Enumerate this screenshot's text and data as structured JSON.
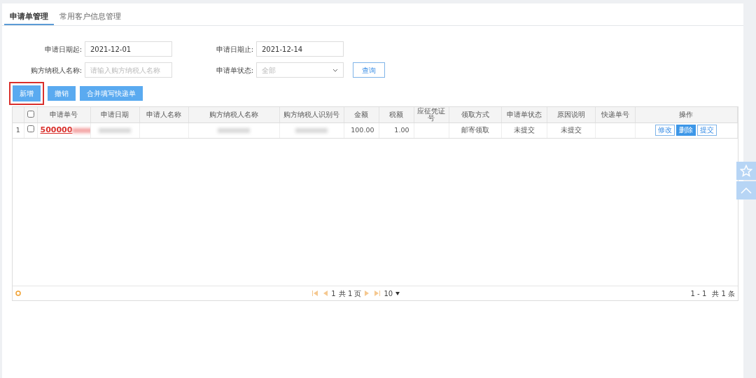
{
  "tabs": [
    {
      "label": "申请单管理",
      "selected": true
    },
    {
      "label": "常用客户信息管理",
      "selected": false
    }
  ],
  "filters": [
    {
      "kind": "text",
      "label": "申请日期起:",
      "value": "2021-12-01"
    },
    {
      "kind": "text",
      "label": "申请日期止:",
      "value": "2021-12-14"
    },
    {
      "kind": "text",
      "label": "购方纳税人名称:",
      "placeholder": "请输入购方纳税人名称"
    },
    {
      "kind": "select",
      "label": "申请单状态:",
      "placeholder": "全部"
    }
  ],
  "query_button": "查询",
  "actions": [
    {
      "label": "新增",
      "highlighted": true
    },
    {
      "label": "撤销",
      "highlighted": false
    },
    {
      "label": "合并填写快递单",
      "highlighted": false
    }
  ],
  "table": {
    "all_checked": false,
    "columns": [
      "申请单号",
      "申请日期",
      "申请人名称",
      "购方纳税人名称",
      "购方纳税人识别号",
      "金额",
      "税额",
      "应征凭证号",
      "领取方式",
      "申请单状态",
      "原因说明",
      "快递单号",
      "操作"
    ],
    "rows": [
      {
        "index": "1",
        "checked": false,
        "cells": [
          "500000",
          "",
          "",
          "",
          "",
          "100.00",
          "1.00",
          "",
          "邮寄领取",
          "未提交",
          "未提交",
          ""
        ],
        "redacted": [
          true,
          true,
          false,
          true,
          true,
          false,
          false,
          false,
          false,
          false,
          false,
          false
        ],
        "ops": [
          {
            "label": "修改",
            "kind": "outline"
          },
          {
            "label": "删除",
            "kind": "solid"
          },
          {
            "label": "提交",
            "kind": "outline"
          }
        ]
      }
    ]
  },
  "pager": {
    "page": "1",
    "total_pages": "共 1 页",
    "page_size": "10",
    "summary": "1 - 1",
    "total": "共 1 条"
  }
}
